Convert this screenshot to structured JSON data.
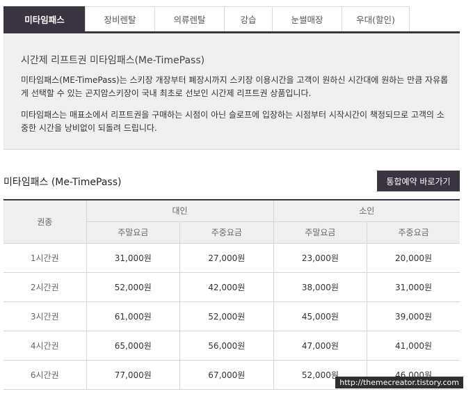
{
  "tabs": [
    "미타임패스",
    "장비렌탈",
    "의류렌탈",
    "강습",
    "눈썰매장",
    "우대(할인)"
  ],
  "info": {
    "title": "시간제 리프트권 미타임패스(Me-TimePass)",
    "para1": "미타임패스(ME-TimePass)는 스키장 개장부터 폐장시까지 스키장 이용시간을 고객이 원하신 시간대에 원하는 만큼 자유롭게 선택할 수 있는 곤지암스키장이 국내 최초로 선보인 시간제 리프트권 상품입니다.",
    "para2": "미타임패스는 매표소에서 리프트권을 구매하는 시점이 아닌 슬로프에 입장하는 시점부터 시작시간이 책정되므로 고객의 소중한 시간을 낭비없이 되돌려 드립니다."
  },
  "section": {
    "title": "미타임패스 (Me-TimePass)",
    "reserve_button": "통합예약 바로가기"
  },
  "table": {
    "kind_header": "권종",
    "adult_header": "대인",
    "child_header": "소인",
    "weekend_header": "주말요금",
    "weekday_header": "주중요금",
    "rows": [
      {
        "name": "1시간권",
        "adult_weekend": "31,000원",
        "adult_weekday": "27,000원",
        "child_weekend": "23,000원",
        "child_weekday": "20,000원"
      },
      {
        "name": "2시간권",
        "adult_weekend": "52,000원",
        "adult_weekday": "42,000원",
        "child_weekend": "38,000원",
        "child_weekday": "31,000원"
      },
      {
        "name": "3시간권",
        "adult_weekend": "61,000원",
        "adult_weekday": "52,000원",
        "child_weekend": "45,000원",
        "child_weekday": "39,000원"
      },
      {
        "name": "4시간권",
        "adult_weekend": "65,000원",
        "adult_weekday": "56,000원",
        "child_weekend": "47,000원",
        "child_weekday": "41,000원"
      },
      {
        "name": "6시간권",
        "adult_weekend": "77,000원",
        "adult_weekday": "67,000원",
        "child_weekend": "52,000원",
        "child_weekday": "46,000원"
      }
    ]
  },
  "watermark": "http://themecreator.tistory.com",
  "colors": {
    "accent": "#3a3440",
    "panel": "#efefef"
  }
}
